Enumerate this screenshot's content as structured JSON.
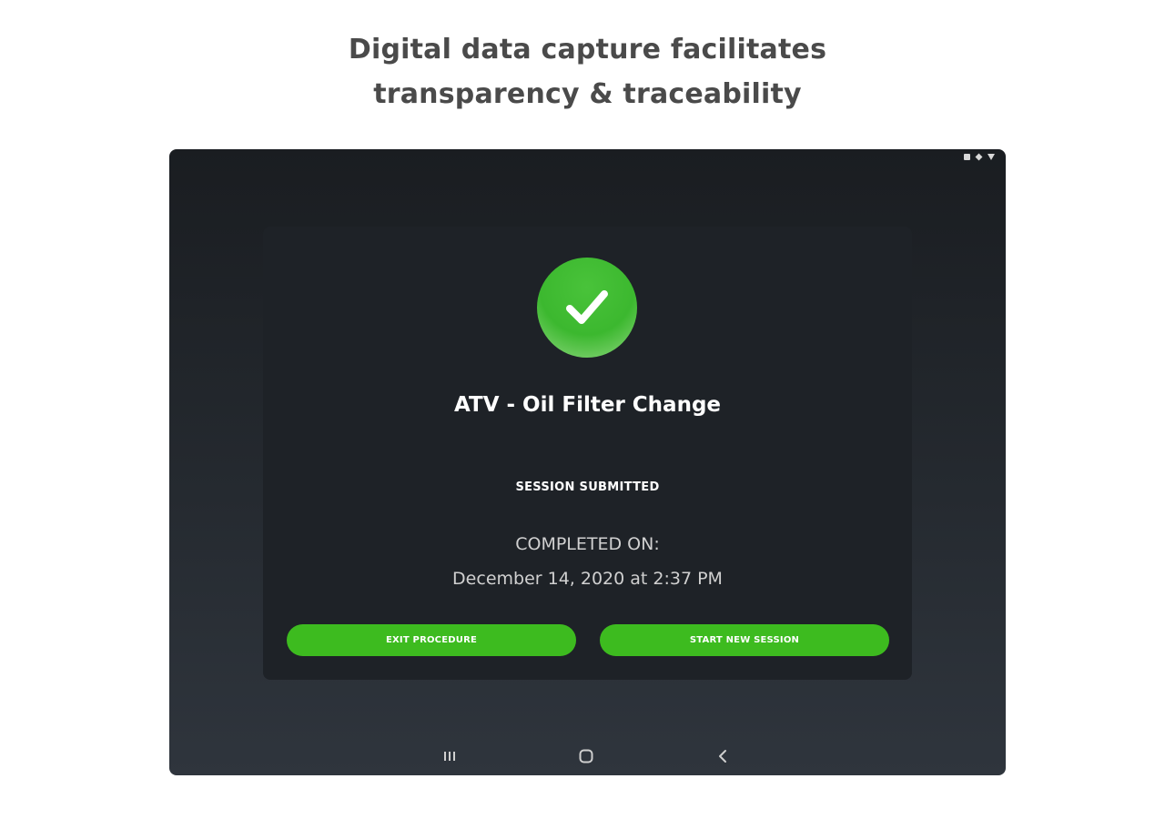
{
  "headline": {
    "line1": "Digital data capture facilitates",
    "line2": "transparency & traceability"
  },
  "status_bar": {
    "icons": [
      "square-indicator-icon",
      "diamond-indicator-icon",
      "wifi-triangle-icon"
    ]
  },
  "completion_card": {
    "status_icon": "checkmark-icon",
    "procedure_title": "ATV - Oil Filter Change",
    "session_status": "SESSION SUBMITTED",
    "completed_label": "COMPLETED ON:",
    "completed_date": "December 14, 2020 at 2:37 PM",
    "buttons": {
      "exit_label": "EXIT PROCEDURE",
      "new_session_label": "START NEW SESSION"
    }
  },
  "nav_bar": {
    "icons": [
      "recents-icon",
      "home-icon",
      "back-icon"
    ]
  },
  "colors": {
    "accent_green": "#3dbb1f",
    "success_circle": "#3cb82f",
    "tablet_background": "#1a1d21",
    "card_background": "#1e2227",
    "headline_text": "#4a4a4a"
  }
}
